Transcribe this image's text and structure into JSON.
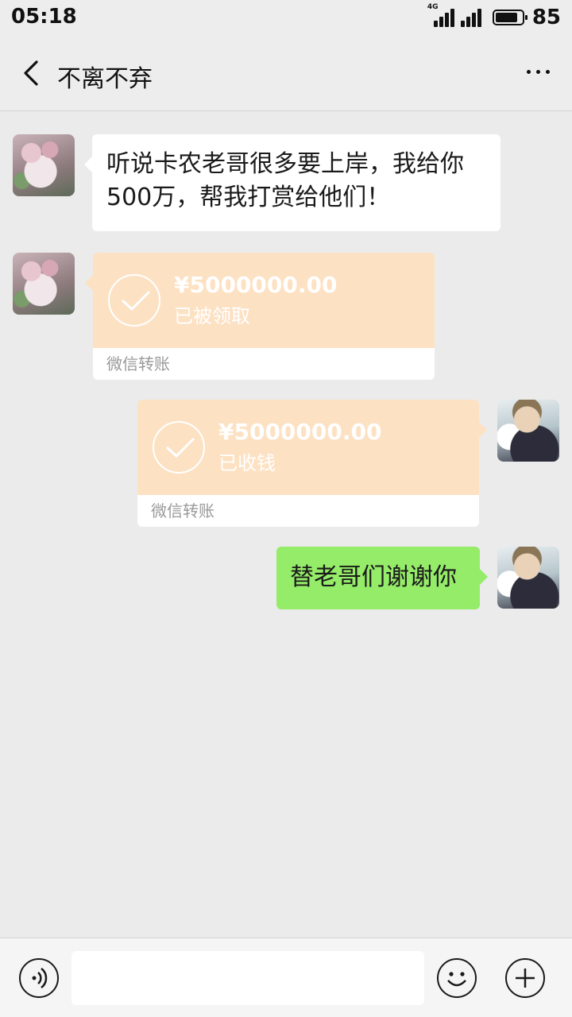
{
  "status_bar": {
    "time": "05:18",
    "network_label": "4G",
    "battery": "85"
  },
  "header": {
    "title": "不离不弃",
    "back_icon": "chevron-left-icon",
    "more_icon": "more-dots-icon"
  },
  "messages": [
    {
      "side": "left",
      "type": "text",
      "lines": [
        "听说卡农老哥很多要上岸，我给你",
        "500万，帮我打赏给他们！"
      ]
    },
    {
      "side": "left",
      "type": "transfer",
      "amount": "¥5000000.00",
      "status": "已被领取",
      "footer": "微信转账"
    },
    {
      "side": "right",
      "type": "transfer",
      "amount": "¥5000000.00",
      "status": "已收钱",
      "footer": "微信转账"
    },
    {
      "side": "right",
      "type": "text",
      "text": "替老哥们谢谢你"
    }
  ],
  "input_bar": {
    "voice_icon": "voice-icon",
    "emoji_icon": "emoji-icon",
    "plus_icon": "plus-icon",
    "placeholder": ""
  },
  "colors": {
    "chat_background": "#ebebeb",
    "transfer_orange": "#fde1c3",
    "sent_green": "#95ec69"
  }
}
